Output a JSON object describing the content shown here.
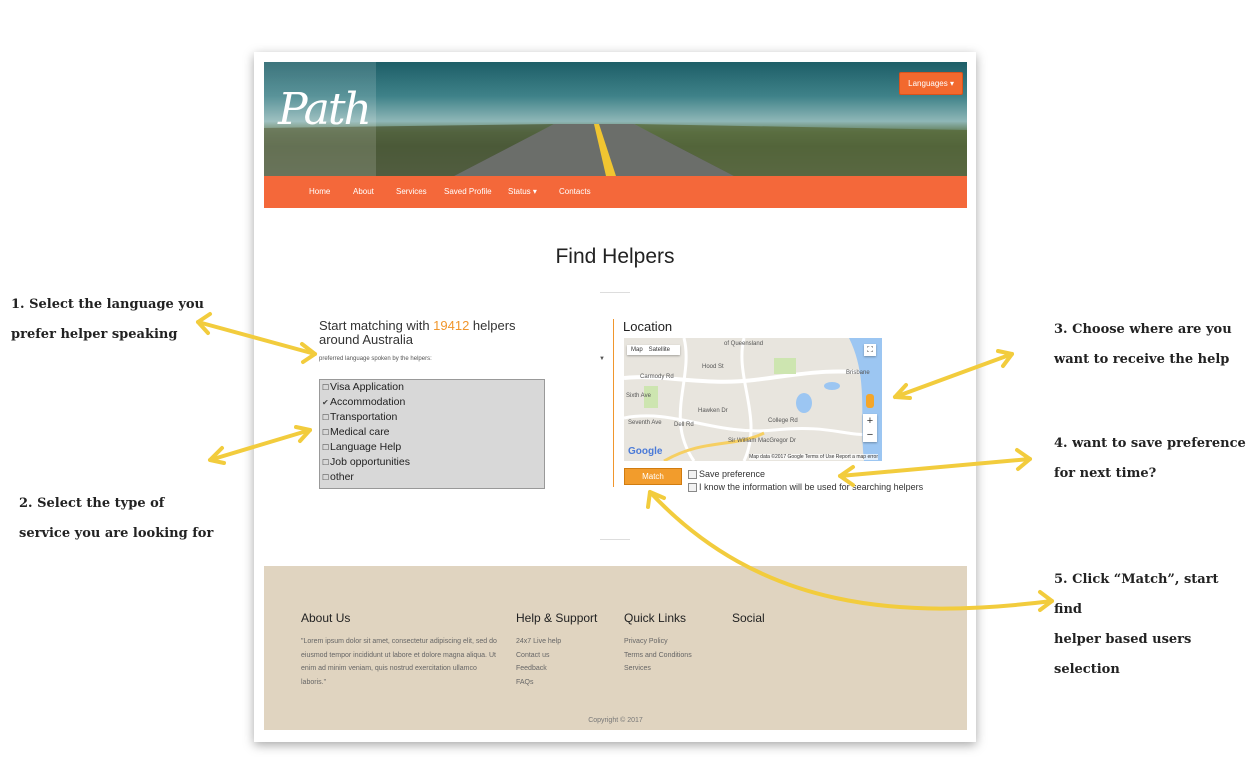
{
  "hero": {
    "logo": "Path",
    "languages_label": "Languages ▾"
  },
  "nav": {
    "items": [
      "Home",
      "About",
      "Services",
      "Saved Profile",
      "Status ▾",
      "Contacts"
    ]
  },
  "main": {
    "title": "Find Helpers",
    "match_prefix": "Start matching with ",
    "match_count": "19412",
    "match_suffix": " helpers around Australia",
    "language_select": "preferred language spoken by the helpers:",
    "services": [
      {
        "label": "Visa Application",
        "checked": false
      },
      {
        "label": "Accommodation",
        "checked": true
      },
      {
        "label": "Transportation",
        "checked": false
      },
      {
        "label": "Medical care",
        "checked": false
      },
      {
        "label": "Language Help",
        "checked": false
      },
      {
        "label": "Job opportunities",
        "checked": false
      },
      {
        "label": "other",
        "checked": false
      }
    ],
    "location_label": "Location",
    "map": {
      "tab_map": "Map",
      "tab_satellite": "Satellite",
      "place_label": "of Queensland",
      "street_labels": [
        "Carmody Rd",
        "Sixth Ave",
        "Hood St",
        "Seventh Ave",
        "Dell Rd",
        "Hawken Dr",
        "College Rd",
        "Sir William MacGregor Dr",
        "Brisbane"
      ],
      "attribution": "Map data ©2017 Google   Terms of Use   Report a map error",
      "google": "Google"
    },
    "match_button": "Match",
    "save_preference": "Save preference",
    "consent": "I know the information will be used for searching helpers"
  },
  "footer": {
    "about_title": "About Us",
    "about_text": "\"Lorem ipsum dolor sit amet, consectetur adipiscing elit, sed do eiusmod tempor incididunt ut labore et dolore magna aliqua. Ut enim ad minim veniam, quis nostrud exercitation ullamco laboris.\"",
    "help_title": "Help & Support",
    "help_links": [
      "24x7 Live help",
      "Contact us",
      "Feedback",
      "FAQs"
    ],
    "quick_title": "Quick Links",
    "quick_links": [
      "Privacy Policy",
      "Terms and Conditions",
      "Services"
    ],
    "social_title": "Social",
    "copyright": "Copyright © 2017"
  },
  "annotations": {
    "note1": [
      "1. Select the language you",
      "prefer helper speaking"
    ],
    "note2": [
      "2. Select the type of",
      "service you are looking for"
    ],
    "note3": [
      "3.  Choose where are you",
      "want to receive the help"
    ],
    "note4": [
      "4. want to save preference",
      "for next time?"
    ],
    "note5": [
      "5. Click “Match”, start find",
      "helper based users",
      "selection"
    ]
  },
  "colors": {
    "accent": "#f4683a",
    "count": "#f0962d",
    "arrow": "#f2cc3d",
    "footer": "#e0d4c0"
  }
}
